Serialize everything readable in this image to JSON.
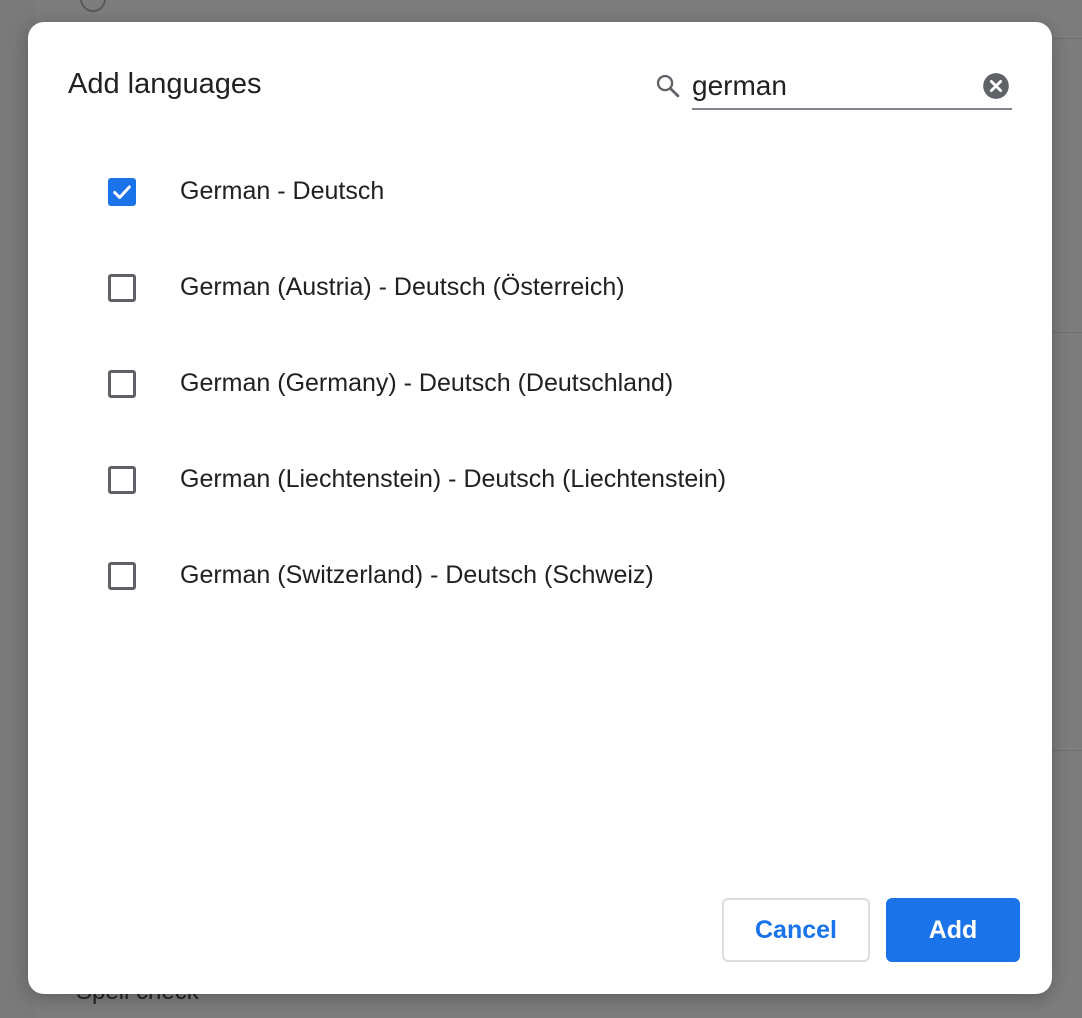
{
  "background": {
    "partial_text": "Spell check"
  },
  "dialog": {
    "title": "Add languages",
    "search": {
      "value": "german",
      "icon": "search-icon",
      "clear_icon": "clear-icon"
    },
    "languages": [
      {
        "label": "German - Deutsch",
        "checked": true
      },
      {
        "label": "German (Austria) - Deutsch (Österreich)",
        "checked": false
      },
      {
        "label": "German (Germany) - Deutsch (Deutschland)",
        "checked": false
      },
      {
        "label": "German (Liechtenstein) - Deutsch (Liechtenstein)",
        "checked": false
      },
      {
        "label": "German (Switzerland) - Deutsch (Schweiz)",
        "checked": false
      }
    ],
    "buttons": {
      "cancel": "Cancel",
      "add": "Add"
    }
  },
  "colors": {
    "accent": "#1a73e8",
    "text": "#202124",
    "checkbox_border": "#5f6368",
    "overlay": "#7a7a7a"
  }
}
